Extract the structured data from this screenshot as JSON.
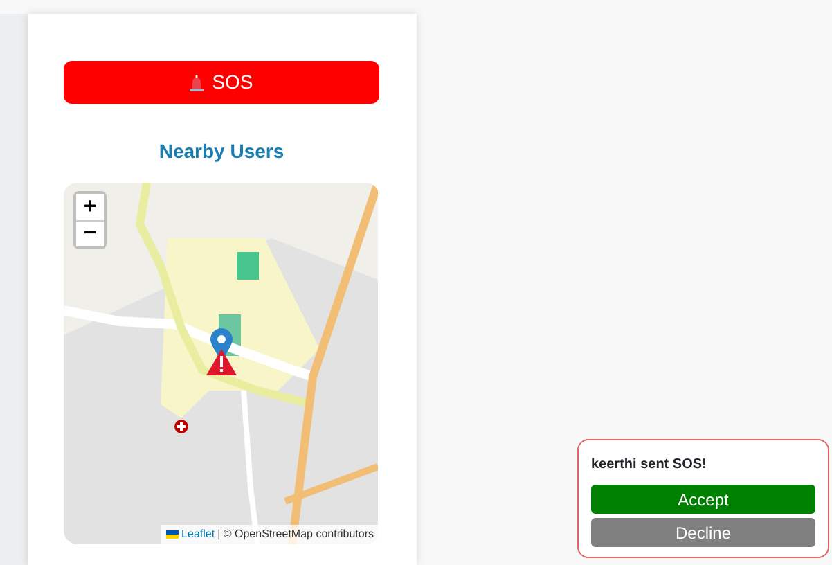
{
  "sos_button": {
    "label": "SOS"
  },
  "nearby": {
    "title": "Nearby Users",
    "map": {
      "kind": "picture",
      "zoom_in": "+",
      "zoom_out": "−",
      "attribution_link": "Leaflet",
      "attribution_text": "| © OpenStreetMap contributors"
    }
  },
  "notification": {
    "message": "keerthi sent SOS!",
    "buttons": [
      {
        "label": "Accept",
        "kind": "accept"
      },
      {
        "label": "Decline",
        "kind": "decline"
      }
    ]
  }
}
